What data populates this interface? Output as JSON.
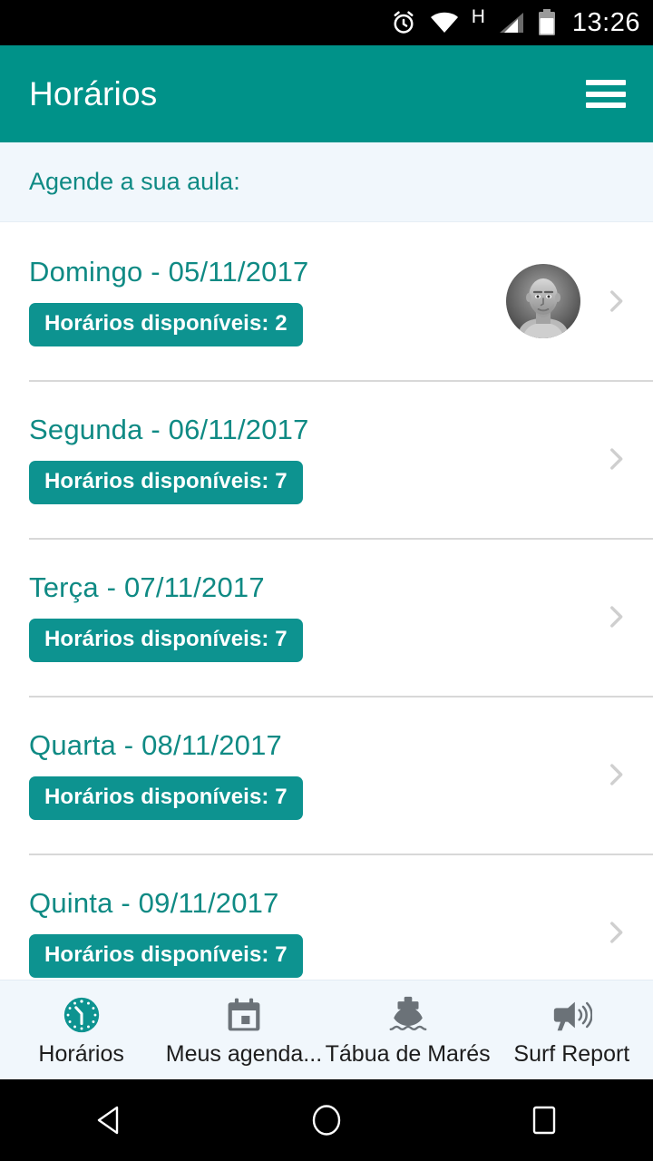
{
  "status_bar": {
    "alarm_icon": "alarm-icon",
    "wifi_icon": "wifi-icon",
    "network_type": "H",
    "signal_icon": "signal-icon",
    "battery_icon": "battery-icon",
    "time": "13:26"
  },
  "app_bar": {
    "title": "Horários",
    "menu_icon": "hamburger-menu-icon"
  },
  "subtitle": {
    "text": "Agende a sua aula:"
  },
  "colors": {
    "primary_teal": "#009289",
    "badge_teal": "#0d9390",
    "title_teal": "#0f8a84",
    "subtitle_bg": "#f1f7fc",
    "tabbar_bg": "#f1f7fc",
    "divider": "#d8d8d8",
    "chevron_gray": "#cfcfcf",
    "tab_inactive": "#6b7278",
    "status_bar_bg": "#000000"
  },
  "schedule_rows": [
    {
      "title": "Domingo - 05/11/2017",
      "badge": "Horários disponíveis: 2",
      "available": 2,
      "has_avatar": true
    },
    {
      "title": "Segunda - 06/11/2017",
      "badge": "Horários disponíveis: 7",
      "available": 7,
      "has_avatar": false
    },
    {
      "title": "Terça - 07/11/2017",
      "badge": "Horários disponíveis: 7",
      "available": 7,
      "has_avatar": false
    },
    {
      "title": "Quarta - 08/11/2017",
      "badge": "Horários disponíveis: 7",
      "available": 7,
      "has_avatar": false
    },
    {
      "title": "Quinta - 09/11/2017",
      "badge": "Horários disponíveis: 7",
      "available": 7,
      "has_avatar": false
    }
  ],
  "tab_bar": [
    {
      "label": "Horários",
      "icon": "clock-icon",
      "active": true
    },
    {
      "label": "Meus agenda...",
      "icon": "calendar-icon",
      "active": false
    },
    {
      "label": "Tábua de Marés",
      "icon": "boat-icon",
      "active": false
    },
    {
      "label": "Surf Report",
      "icon": "megaphone-icon",
      "active": false
    }
  ],
  "android_nav": {
    "back": "back-triangle-icon",
    "home": "home-circle-icon",
    "recents": "recents-square-icon"
  }
}
